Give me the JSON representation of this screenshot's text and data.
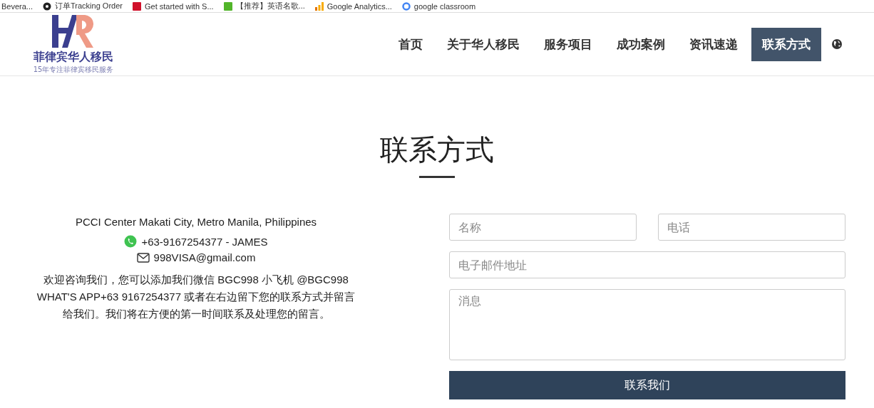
{
  "bookmarks": [
    {
      "label": "Bevera..."
    },
    {
      "label": "订单Tracking Order"
    },
    {
      "label": "Get started with S..."
    },
    {
      "label": "【推荐】英语名歌..."
    },
    {
      "label": "Google Analytics..."
    },
    {
      "label": "google classroom"
    }
  ],
  "logo": {
    "name": "菲律宾华人移民",
    "tagline": "15年专注菲律宾移民服务"
  },
  "nav": [
    {
      "label": "首页",
      "selected": false
    },
    {
      "label": "关于华人移民",
      "selected": false
    },
    {
      "label": "服务项目",
      "selected": false
    },
    {
      "label": "成功案例",
      "selected": false
    },
    {
      "label": "资讯速递",
      "selected": false
    },
    {
      "label": "联系方式",
      "selected": true
    }
  ],
  "page_title": "联系方式",
  "contact": {
    "address": "PCCI Center Makati City, Metro Manila, Philippines",
    "lines": [
      {
        "kind": "whatsapp",
        "text": "+63-9167254377 - JAMES"
      },
      {
        "kind": "email",
        "text": "998VISA@gmail.com"
      }
    ],
    "message": "欢迎咨询我们，您可以添加我们微信 BGC998 小飞机 @BGC998 WHAT'S APP+63 9167254377  或者在右边留下您的联系方式并留言给我们。我们将在方便的第一时间联系及处理您的留言。"
  },
  "form": {
    "name": {
      "placeholder": "名称"
    },
    "phone": {
      "placeholder": "电话"
    },
    "email": {
      "placeholder": "电子邮件地址"
    },
    "message": {
      "placeholder": "消息"
    },
    "submit": "联系我们"
  }
}
